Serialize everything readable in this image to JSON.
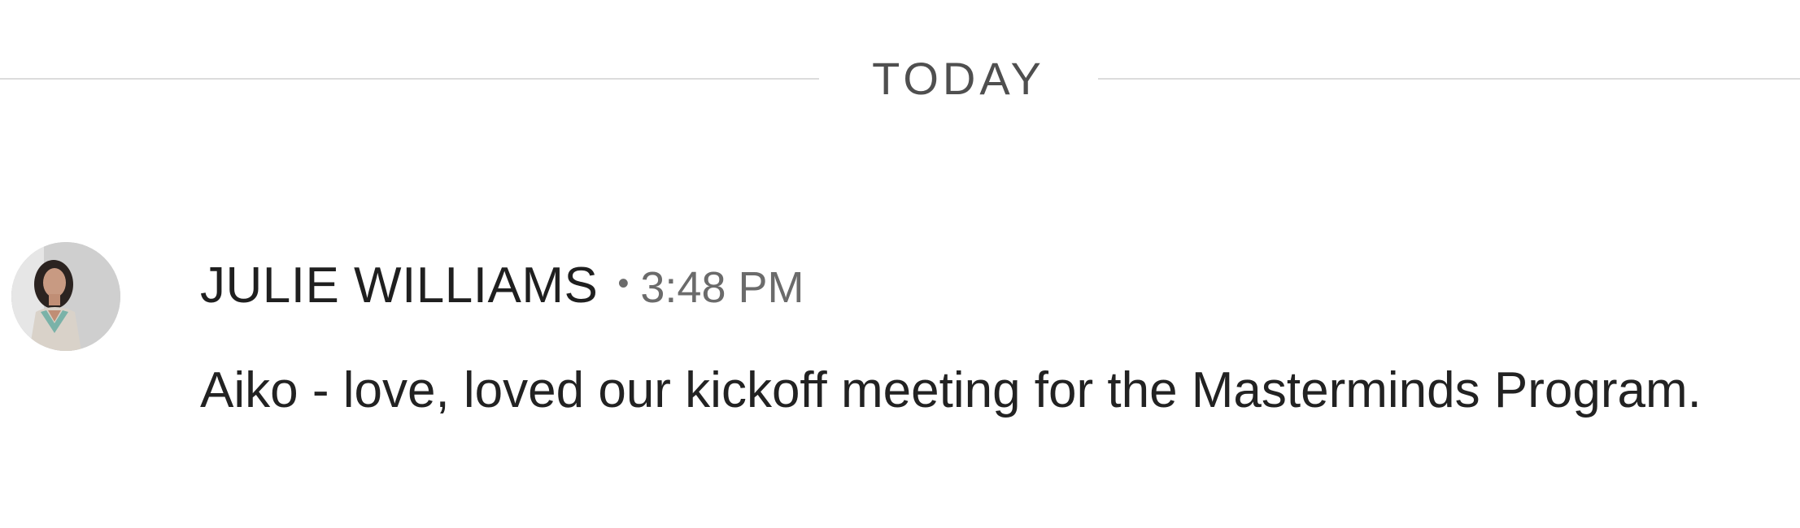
{
  "divider": {
    "label": "TODAY"
  },
  "message": {
    "author": "JULIE WILLIAMS",
    "separator": "•",
    "time": "3:48 PM",
    "text": "Aiko - love, loved our kickoff meeting for the Masterminds Program."
  },
  "colors": {
    "divider_line": "#dcdcdc",
    "divider_text": "#4f4f4f",
    "author_text": "#1f1f1f",
    "time_text": "#6b6b6b",
    "body_text": "#222222"
  }
}
